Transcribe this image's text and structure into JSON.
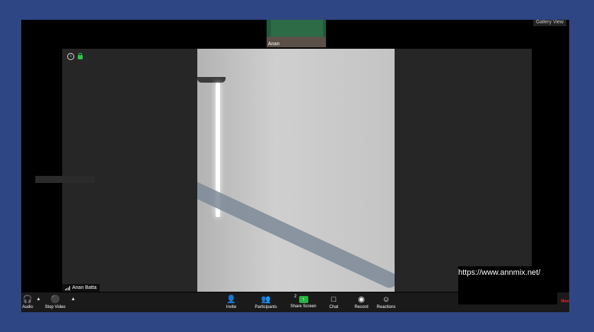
{
  "thumbnail": {
    "name": "Anan"
  },
  "view_toggle": {
    "label": "Gallery View"
  },
  "participant": {
    "name": "Anan Batta"
  },
  "toolbar": {
    "audio_label": "Audio",
    "stop_video_label": "Stop Video",
    "invite_label": "Invite",
    "participants_label": "Participants",
    "participants_count": "2",
    "share_screen_label": "Share Screen",
    "chat_label": "Chat",
    "record_label": "Record",
    "reactions_label": "Reactions",
    "end_label": "Mee"
  },
  "watermark": {
    "text": "https://www.annmix.net/"
  },
  "icons": {
    "audio": "headphones-icon",
    "video": "camera-icon",
    "invite": "add-person-icon",
    "participants": "people-icon",
    "share": "share-up-arrow-icon",
    "chat": "chat-bubble-icon",
    "record": "record-icon",
    "reactions": "smiley-plus-icon",
    "info": "info-icon",
    "lock": "lock-icon"
  },
  "colors": {
    "background": "#2f4684",
    "share_accent": "#26b341",
    "end_red": "#e02828"
  }
}
